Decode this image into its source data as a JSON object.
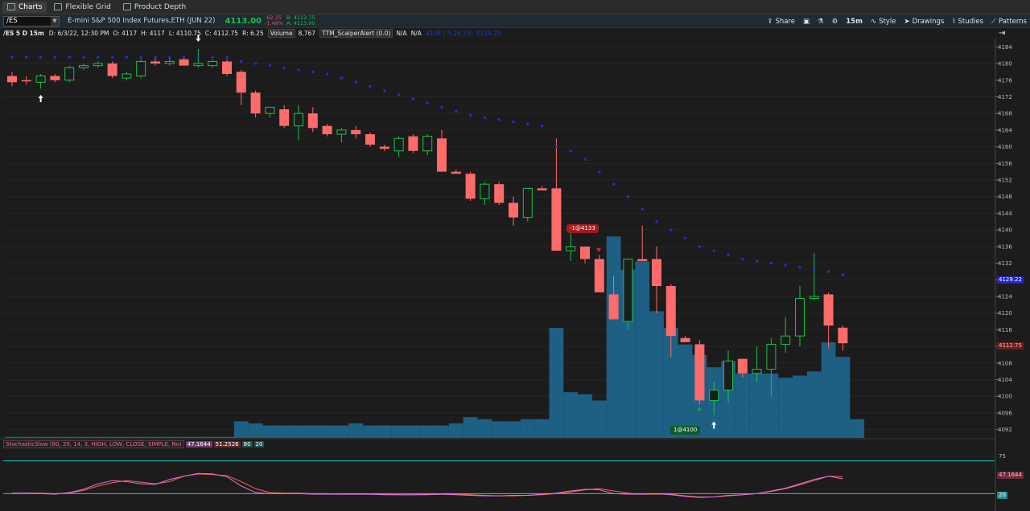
{
  "tabs": [
    {
      "label": "Charts",
      "active": true
    },
    {
      "label": "Flexible Grid",
      "active": false
    },
    {
      "label": "Product Depth",
      "active": false
    }
  ],
  "symbol_bar": {
    "symbol": "/ES",
    "description": "E-mini S&P 500 Index Futures,ETH (JUN 22)",
    "last": "4113.00",
    "change": "-62.25",
    "change_pct": "-1.49%",
    "bid": "B: 4112.75",
    "ask": "A: 4113.00"
  },
  "toolbar": {
    "share": "Share",
    "timeframe": "15m",
    "style": "Style",
    "drawings": "Drawings",
    "studies": "Studies",
    "patterns": "Patterns"
  },
  "info_bar": {
    "symbol_period": "/ES 5 D 15m",
    "date": "D: 6/3/22, 12:30 PM",
    "open": "O: 4117",
    "high": "H: 4117",
    "low": "L: 4110.75",
    "close": "C: 4112.75",
    "range": "R: 6.25",
    "volume_label": "Volume",
    "volume": "8,767",
    "study": "TTM_ScalperAlert (0.0)",
    "na1": "N/A",
    "na2": "N/A",
    "hidden1": "4108 (-5.26 25)",
    "hidden2": "4124.25"
  },
  "stoch_bar": {
    "label": "StochasticSlow (80, 20, 14, 3, HIGH, LOW, CLOSE, SIMPLE, No)",
    "k": "47.1644",
    "d": "51.2526",
    "ob": "80",
    "os": "20"
  },
  "price_tags": {
    "current_blue": "4129.22",
    "current_red": "4112.75",
    "stoch_tag": "47.1644",
    "stoch_os_tag": "20",
    "stoch_75": "75"
  },
  "annotations": {
    "sell": "-1@4133",
    "buy": "1@4100"
  },
  "colors": {
    "background": "#1c1c1c",
    "up": "#19c24a",
    "down": "#ff6b6b",
    "volume": "#1e5f84",
    "psar": "#2b2bd0",
    "stoch_k": "#e070e0",
    "stoch_d": "#ff6060",
    "level": "#20c8c8"
  },
  "chart_data": {
    "type": "candlestick",
    "title": "",
    "ylim": [
      4090,
      4186
    ],
    "ytick_labels": [
      "4184",
      "4180",
      "4176",
      "4172",
      "4168",
      "4164",
      "4160",
      "4156",
      "4152",
      "4148",
      "4144",
      "4140",
      "4136",
      "4132",
      "4128",
      "4124",
      "4120",
      "4116",
      "4112",
      "4108",
      "4104",
      "4100",
      "4096",
      "4092"
    ],
    "candles": [
      [
        4177,
        4178,
        4174.5,
        4175.5
      ],
      [
        4176,
        4177,
        4175,
        4176
      ],
      [
        4175.5,
        4177.5,
        4174,
        4177
      ],
      [
        4177,
        4177.5,
        4175.5,
        4176
      ],
      [
        4176,
        4179.5,
        4175.5,
        4179
      ],
      [
        4179,
        4180,
        4178.5,
        4179.5
      ],
      [
        4179.5,
        4180.5,
        4179,
        4180
      ],
      [
        4180,
        4180.5,
        4176.5,
        4177
      ],
      [
        4176.5,
        4178,
        4176,
        4177.5
      ],
      [
        4177,
        4181,
        4176.5,
        4180.5
      ],
      [
        4180.5,
        4181.5,
        4179.5,
        4180
      ],
      [
        4180,
        4181.5,
        4179.5,
        4180.5
      ],
      [
        4181,
        4181.5,
        4179.5,
        4179.5
      ],
      [
        4179.5,
        4183.5,
        4179,
        4180
      ],
      [
        4179.5,
        4181,
        4179,
        4180.5
      ],
      [
        4180.5,
        4181,
        4177,
        4177.5
      ],
      [
        4178,
        4178.5,
        4170,
        4173
      ],
      [
        4173,
        4173.5,
        4167,
        4168
      ],
      [
        4168,
        4169.5,
        4167,
        4169.5
      ],
      [
        4169,
        4170,
        4164.5,
        4165
      ],
      [
        4165,
        4170,
        4161.5,
        4168
      ],
      [
        4168,
        4169.5,
        4163.5,
        4164.5
      ],
      [
        4165,
        4165.5,
        4162.5,
        4163
      ],
      [
        4163,
        4164.5,
        4161,
        4164
      ],
      [
        4164,
        4165,
        4162,
        4163
      ],
      [
        4163,
        4163.5,
        4160,
        4160.5
      ],
      [
        4160,
        4160.5,
        4159,
        4159.5
      ],
      [
        4159,
        4162.5,
        4157.5,
        4162
      ],
      [
        4162.5,
        4163,
        4158.5,
        4159
      ],
      [
        4159,
        4163,
        4158,
        4162.5
      ],
      [
        4162,
        4164,
        4154,
        4154
      ],
      [
        4154,
        4154.5,
        4153.5,
        4153.5
      ],
      [
        4153.5,
        4154,
        4147,
        4147.5
      ],
      [
        4147.5,
        4151.5,
        4146,
        4151
      ],
      [
        4151,
        4151.5,
        4146,
        4146.5
      ],
      [
        4146.5,
        4148,
        4141,
        4143
      ],
      [
        4143,
        4150,
        4142,
        4150
      ],
      [
        4150,
        4150.5,
        4149.5,
        4149.5
      ],
      [
        4150,
        4162,
        4135,
        4135
      ],
      [
        4135,
        4140,
        4132.5,
        4136
      ],
      [
        4136,
        4136,
        4132,
        4133
      ],
      [
        4133,
        4134,
        4125,
        4125
      ],
      [
        4124.5,
        4129,
        4118.5,
        4118.5
      ],
      [
        4118,
        4133,
        4116,
        4133
      ],
      [
        4133,
        4141,
        4132.5,
        4132.5
      ],
      [
        4133,
        4136,
        4120,
        4126.5
      ],
      [
        4126.5,
        4127,
        4109.5,
        4114.5
      ],
      [
        4114,
        4114.5,
        4113,
        4113
      ],
      [
        4112.5,
        4113.5,
        4098,
        4099
      ],
      [
        4099,
        4103.5,
        4095.5,
        4101.5
      ],
      [
        4101.5,
        4111,
        4098.5,
        4108.5
      ],
      [
        4109,
        4109,
        4104.5,
        4105.5
      ],
      [
        4105.5,
        4112,
        4103.5,
        4106.5
      ],
      [
        4106.5,
        4114,
        4100,
        4112.5
      ],
      [
        4112.5,
        4119,
        4110.5,
        4114.5
      ],
      [
        4114.5,
        4126.5,
        4112,
        4123.5
      ],
      [
        4123.5,
        4134.5,
        4123,
        4124
      ],
      [
        4124.5,
        4125,
        4111.5,
        4117
      ],
      [
        4116.5,
        4117,
        4111,
        4112.75
      ]
    ],
    "volume": [
      0.5,
      0.5,
      0.5,
      0.5,
      0.5,
      0.5,
      0.5,
      0.5,
      0.5,
      0.5,
      0.5,
      0.5,
      0.5,
      0.5,
      0.5,
      0.5,
      8,
      7,
      6,
      6,
      6,
      6,
      6,
      6,
      7,
      6,
      6,
      6,
      6,
      6,
      6,
      7,
      10,
      9,
      8,
      8,
      9,
      9,
      53,
      22,
      21,
      18,
      97,
      81,
      85,
      61,
      53,
      45,
      40,
      34,
      37,
      31,
      31,
      31,
      29,
      30,
      32,
      46,
      39,
      9
    ],
    "psar": [
      4181.5,
      4181.5,
      4181.5,
      4181.5,
      4181.5,
      4181.5,
      4181.5,
      4181.5,
      4181.5,
      4181.5,
      4181.5,
      4181.5,
      4181.5,
      4181.5,
      4181.5,
      4181.5,
      4180.5,
      4180,
      4179.5,
      4179,
      4178.5,
      4178,
      4177.5,
      4176.5,
      4175.5,
      4174.5,
      4173.5,
      4172.5,
      4171.5,
      4170.5,
      4169.5,
      4168.5,
      4167.5,
      4167,
      4166.5,
      4166,
      4165.5,
      4165,
      4160,
      4159,
      4157,
      4154,
      4151,
      4148,
      4145,
      4142,
      4140,
      4138,
      4136,
      4135,
      4134,
      4133,
      4132.5,
      4132,
      4131.5,
      4131,
      4130.5,
      4130,
      4129.22
    ],
    "signals": [
      {
        "index": 2,
        "type": "buy"
      },
      {
        "index": 13,
        "type": "sell"
      },
      {
        "index": 49,
        "type": "buy"
      }
    ],
    "stochastic": {
      "ylim": [
        0,
        100
      ],
      "levels": [
        80,
        20
      ],
      "k": [
        21,
        21,
        20,
        19,
        22,
        28,
        38,
        44,
        42,
        38,
        37,
        46,
        52,
        57,
        56,
        51,
        34,
        22,
        20,
        20,
        20,
        19,
        19,
        19,
        19,
        19,
        18,
        18,
        18,
        19,
        19,
        18,
        17,
        16,
        16,
        17,
        17,
        19,
        21,
        25,
        28,
        27,
        20,
        19,
        19,
        20,
        18,
        15,
        13,
        14,
        17,
        18,
        20,
        25,
        30,
        38,
        46,
        52,
        47
      ],
      "d": [
        20,
        21,
        21,
        20,
        21,
        26,
        34,
        40,
        44,
        41,
        38,
        42,
        52,
        56,
        55,
        53,
        42,
        29,
        22,
        21,
        21,
        20,
        20,
        19,
        19,
        19,
        19,
        18,
        18,
        18,
        19,
        19,
        18,
        17,
        16,
        16,
        17,
        18,
        20,
        23,
        27,
        29,
        25,
        21,
        19,
        19,
        19,
        16,
        14,
        14,
        16,
        18,
        20,
        24,
        29,
        36,
        44,
        52,
        51
      ]
    }
  }
}
